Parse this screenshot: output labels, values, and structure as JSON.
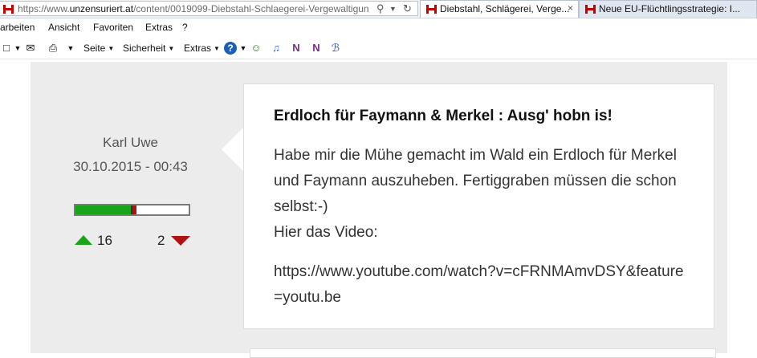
{
  "browser": {
    "url_prefix": "https://www.",
    "url_host": "unzensuriert.at",
    "url_path": "/content/0019099-Diebstahl-Schlaegerei-Vergewaltigun",
    "tabs": [
      {
        "label": "Diebstahl, Schlägerei, Verge...",
        "close": "×",
        "active": true
      },
      {
        "label": "Neue EU-Flüchtlingsstrategie: I...",
        "active": false
      }
    ],
    "menu": [
      "arbeiten",
      "Ansicht",
      "Favoriten",
      "Extras",
      "?"
    ],
    "commandbar": {
      "page_label": "Seite",
      "security_label": "Sicherheit",
      "extras_label": "Extras"
    },
    "accent_color": "#c00000"
  },
  "comment": {
    "author": "Karl Uwe",
    "date": "30.10.2015 - 00:43",
    "rating": {
      "up_fraction": 0.49,
      "down_fraction": 0.05
    },
    "votes_up": "16",
    "votes_down": "2",
    "up_color": "#1aa41a",
    "down_color": "#b01212",
    "title": "Erdloch für Faymann & Merkel : Ausg' hobn is!",
    "body_lines": [
      "Habe mir die Mühe gemacht im Wald ein Erdloch für Merkel und Faymann auszuheben. Fertiggraben müssen die schon selbst:-)",
      "Hier das Video:"
    ],
    "link_text": "https://www.youtube.com/watch?v=cFRNMAmvDSY&feature=youtu.be"
  }
}
